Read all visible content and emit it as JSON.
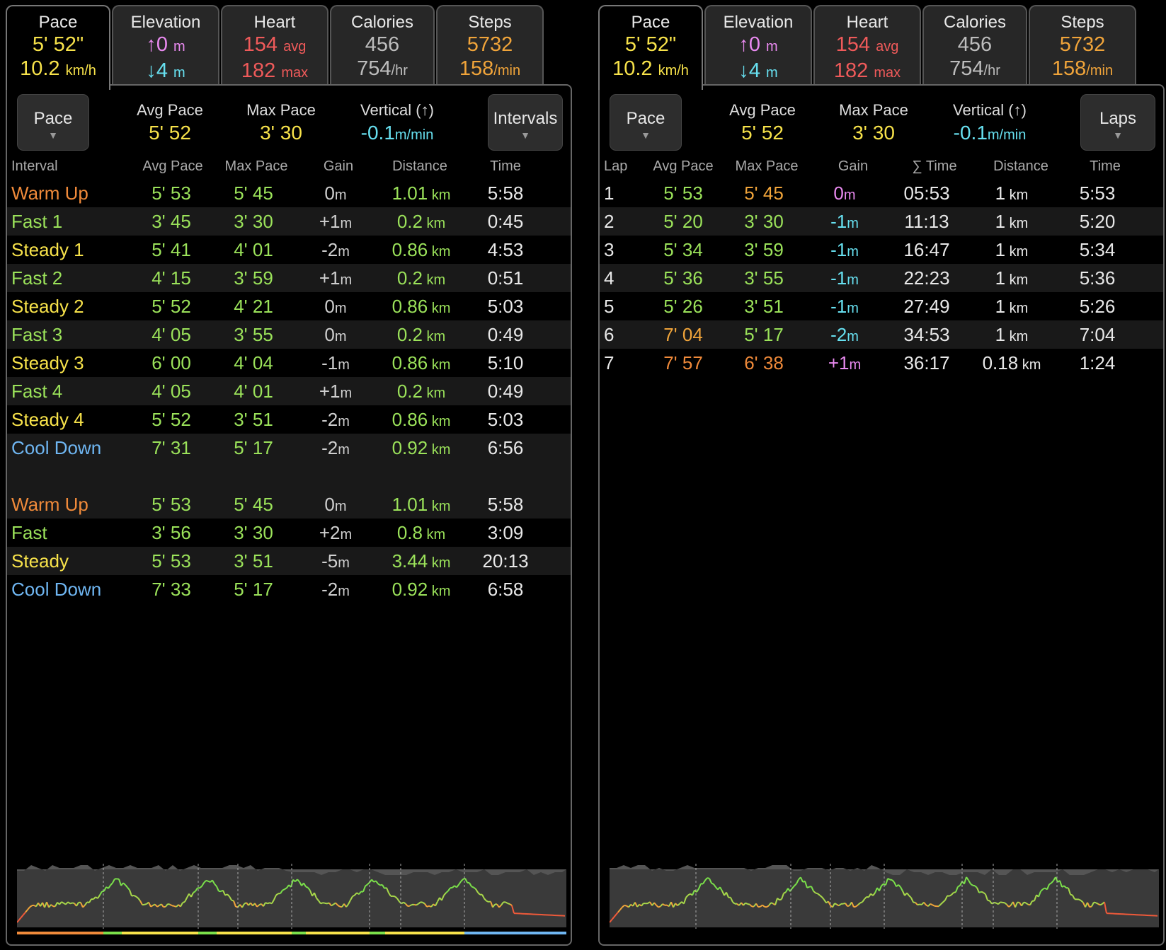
{
  "colors": {
    "yellow": "#f7e24a",
    "green": "#9be25a",
    "orange": "#f08a3a",
    "blue": "#6fb6f2",
    "pink": "#e98af0",
    "cyan": "#67e0f0",
    "red": "#ef5a5a",
    "gray": "#bdbdbd",
    "amber": "#f0a43a"
  },
  "tabs": {
    "pace": {
      "title": "Pace",
      "value": "5' 52\"",
      "speed": "10.2",
      "speed_unit": "km/h"
    },
    "elevation": {
      "title": "Elevation",
      "up": "↑0",
      "up_unit": "m",
      "down": "↓4",
      "down_unit": "m"
    },
    "heart": {
      "title": "Heart",
      "avg": "154",
      "avg_unit": "avg",
      "max": "182",
      "max_unit": "max"
    },
    "calories": {
      "title": "Calories",
      "total": "456",
      "rate": "754",
      "rate_unit": "/hr"
    },
    "steps": {
      "title": "Steps",
      "total": "5732",
      "cadence": "158",
      "cadence_unit": "/min"
    }
  },
  "summary": {
    "metric_button": "Pace",
    "avg_pace_label": "Avg Pace",
    "avg_pace": "5' 52",
    "max_pace_label": "Max Pace",
    "max_pace": "3' 30",
    "vertical_label": "Vertical (↑)",
    "vertical": "-0.1",
    "vertical_unit": "m/min",
    "dropdown_arrow": "▼"
  },
  "intervals": {
    "mode_button": "Intervals",
    "headers": [
      "Interval",
      "Avg Pace",
      "Max Pace",
      "Gain",
      "Distance",
      "Time"
    ],
    "rows": [
      {
        "name": "Warm Up",
        "avg": "5' 53",
        "max": "5' 45",
        "gain": "0",
        "dist": "1.01",
        "time": "5:58",
        "color": "orange"
      },
      {
        "name": "Fast 1",
        "avg": "3' 45",
        "max": "3' 30",
        "gain": "+1",
        "dist": "0.2",
        "time": "0:45",
        "color": "green"
      },
      {
        "name": "Steady 1",
        "avg": "5' 41",
        "max": "4' 01",
        "gain": "-2",
        "dist": "0.86",
        "time": "4:53",
        "color": "yellow"
      },
      {
        "name": "Fast 2",
        "avg": "4' 15",
        "max": "3' 59",
        "gain": "+1",
        "dist": "0.2",
        "time": "0:51",
        "color": "green"
      },
      {
        "name": "Steady 2",
        "avg": "5' 52",
        "max": "4' 21",
        "gain": "0",
        "dist": "0.86",
        "time": "5:03",
        "color": "yellow"
      },
      {
        "name": "Fast 3",
        "avg": "4' 05",
        "max": "3' 55",
        "gain": "0",
        "dist": "0.2",
        "time": "0:49",
        "color": "green"
      },
      {
        "name": "Steady 3",
        "avg": "6' 00",
        "max": "4' 04",
        "gain": "-1",
        "dist": "0.86",
        "time": "5:10",
        "color": "yellow"
      },
      {
        "name": "Fast 4",
        "avg": "4' 05",
        "max": "4' 01",
        "gain": "+1",
        "dist": "0.2",
        "time": "0:49",
        "color": "green"
      },
      {
        "name": "Steady 4",
        "avg": "5' 52",
        "max": "3' 51",
        "gain": "-2",
        "dist": "0.86",
        "time": "5:03",
        "color": "yellow"
      },
      {
        "name": "Cool Down",
        "avg": "7' 31",
        "max": "5' 17",
        "gain": "-2",
        "dist": "0.92",
        "time": "6:56",
        "color": "blue"
      }
    ],
    "summary_rows": [
      {
        "name": "Warm Up",
        "avg": "5' 53",
        "max": "5' 45",
        "gain": "0",
        "dist": "1.01",
        "time": "5:58",
        "color": "orange"
      },
      {
        "name": "Fast",
        "avg": "3' 56",
        "max": "3' 30",
        "gain": "+2",
        "dist": "0.8",
        "time": "3:09",
        "color": "green"
      },
      {
        "name": "Steady",
        "avg": "5' 53",
        "max": "3' 51",
        "gain": "-5",
        "dist": "3.44",
        "time": "20:13",
        "color": "yellow"
      },
      {
        "name": "Cool Down",
        "avg": "7' 33",
        "max": "5' 17",
        "gain": "-2",
        "dist": "0.92",
        "time": "6:58",
        "color": "blue"
      }
    ]
  },
  "laps": {
    "mode_button": "Laps",
    "headers": [
      "Lap",
      "Avg Pace",
      "Max Pace",
      "Gain",
      "∑ Time",
      "Distance",
      "Time"
    ],
    "rows": [
      {
        "lap": "1",
        "avg": "5' 53",
        "max": "5' 45",
        "gain": "0",
        "cum": "05:53",
        "dist": "1",
        "time": "5:53",
        "avg_color": "green",
        "max_color": "amber",
        "gain_color": "pink"
      },
      {
        "lap": "2",
        "avg": "5' 20",
        "max": "3' 30",
        "gain": "-1",
        "cum": "11:13",
        "dist": "1",
        "time": "5:20",
        "avg_color": "green",
        "max_color": "green",
        "gain_color": "cyan"
      },
      {
        "lap": "3",
        "avg": "5' 34",
        "max": "3' 59",
        "gain": "-1",
        "cum": "16:47",
        "dist": "1",
        "time": "5:34",
        "avg_color": "green",
        "max_color": "green",
        "gain_color": "cyan"
      },
      {
        "lap": "4",
        "avg": "5' 36",
        "max": "3' 55",
        "gain": "-1",
        "cum": "22:23",
        "dist": "1",
        "time": "5:36",
        "avg_color": "green",
        "max_color": "green",
        "gain_color": "cyan"
      },
      {
        "lap": "5",
        "avg": "5' 26",
        "max": "3' 51",
        "gain": "-1",
        "cum": "27:49",
        "dist": "1",
        "time": "5:26",
        "avg_color": "green",
        "max_color": "green",
        "gain_color": "cyan"
      },
      {
        "lap": "6",
        "avg": "7' 04",
        "max": "5' 17",
        "gain": "-2",
        "cum": "34:53",
        "dist": "1",
        "time": "7:04",
        "avg_color": "amber",
        "max_color": "green",
        "gain_color": "cyan"
      },
      {
        "lap": "7",
        "avg": "7' 57",
        "max": "6' 38",
        "gain": "+1",
        "cum": "36:17",
        "dist": "0.18",
        "time": "1:24",
        "avg_color": "orange",
        "max_color": "orange",
        "gain_color": "pink"
      }
    ]
  },
  "units": {
    "m": "m",
    "km": "km"
  }
}
